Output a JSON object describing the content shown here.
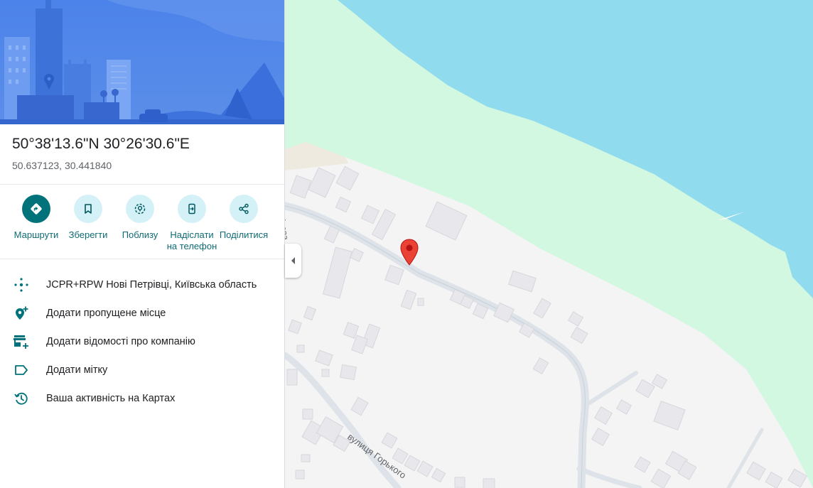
{
  "place": {
    "dms": "50°38'13.6\"N 30°26'30.6\"E",
    "decimal": "50.637123, 30.441840"
  },
  "actions": [
    {
      "label": "Маршрути",
      "icon": "directions-icon"
    },
    {
      "label": "Зберегти",
      "icon": "bookmark-icon"
    },
    {
      "label": "Поблизу",
      "icon": "nearby-icon"
    },
    {
      "label": "Надіслати на телефон",
      "icon": "send-to-phone-icon"
    },
    {
      "label": "Поділитися",
      "icon": "share-icon"
    }
  ],
  "info": [
    {
      "text": "JCPR+RPW Нові Петрівці, Київська область",
      "icon": "plus-code-icon"
    },
    {
      "text": "Додати пропущене місце",
      "icon": "add-place-icon"
    },
    {
      "text": "Додати відомості про компанію",
      "icon": "add-business-icon"
    },
    {
      "text": "Додати мітку",
      "icon": "label-icon"
    },
    {
      "text": "Ваша активність на Картах",
      "icon": "history-icon"
    }
  ],
  "map": {
    "street_labels": [
      "ірова",
      "вулиця Горького"
    ],
    "colors": {
      "water": "#90dbee",
      "park": "#d3f8e2",
      "land": "#f4f4f4",
      "accent": "#00737a",
      "pin": "#ea4335"
    }
  }
}
